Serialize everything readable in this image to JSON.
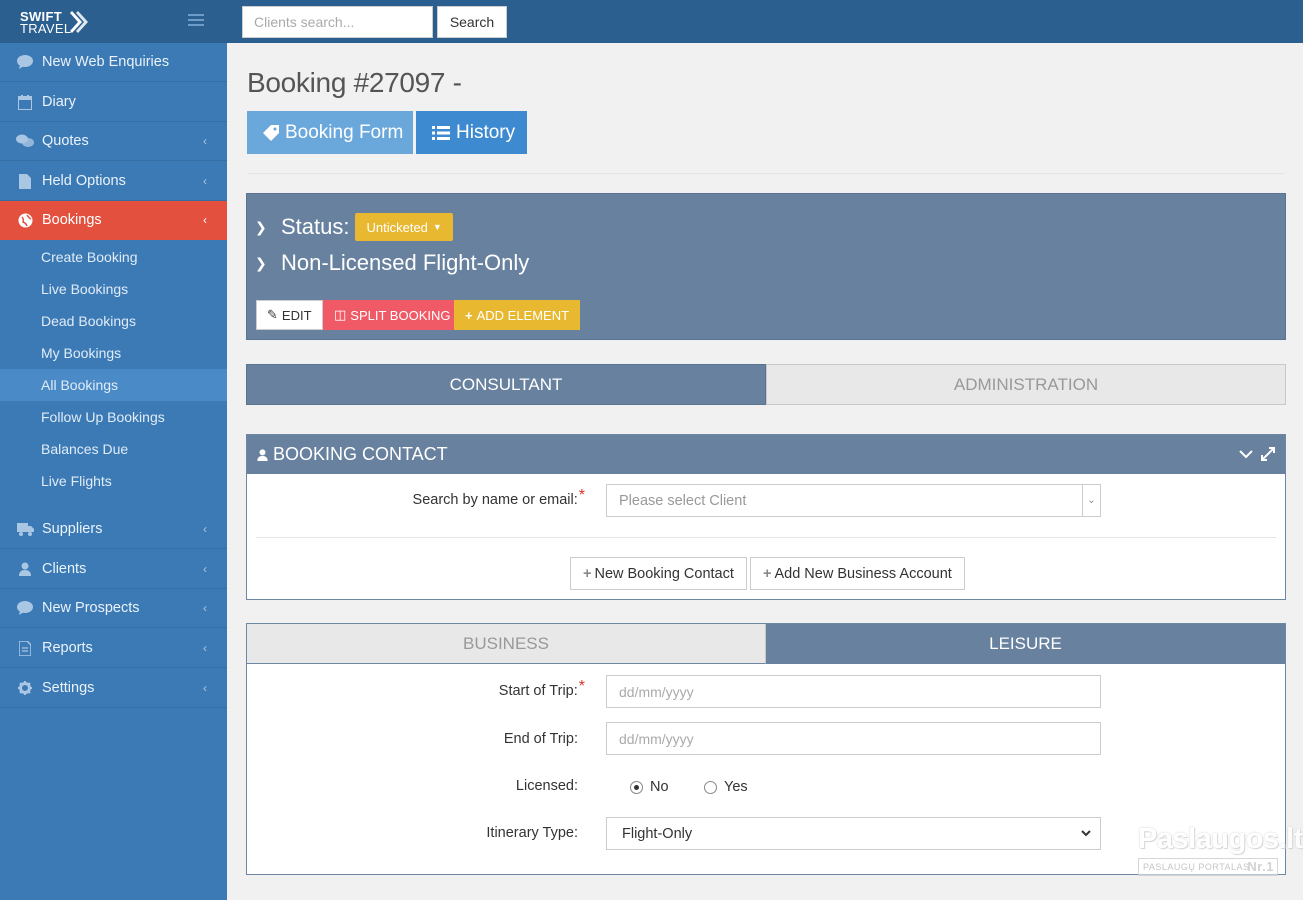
{
  "brand": {
    "line1": "SWIFT",
    "line2": "TRAVEL"
  },
  "topbar": {
    "search_placeholder": "Clients search...",
    "search_button": "Search"
  },
  "sidebar": {
    "items": [
      {
        "label": "New Web Enquiries",
        "icon": "comment-icon",
        "has_chevron": false
      },
      {
        "label": "Diary",
        "icon": "calendar-icon",
        "has_chevron": false
      },
      {
        "label": "Quotes",
        "icon": "comments-icon",
        "has_chevron": true
      },
      {
        "label": "Held Options",
        "icon": "file-icon",
        "has_chevron": true
      },
      {
        "label": "Bookings",
        "icon": "globe-icon",
        "has_chevron": true,
        "active": true
      },
      {
        "label": "Suppliers",
        "icon": "truck-icon",
        "has_chevron": true
      },
      {
        "label": "Clients",
        "icon": "user-icon",
        "has_chevron": true
      },
      {
        "label": "New Prospects",
        "icon": "comment-icon",
        "has_chevron": true
      },
      {
        "label": "Reports",
        "icon": "file-text-icon",
        "has_chevron": true
      },
      {
        "label": "Settings",
        "icon": "gear-icon",
        "has_chevron": true
      }
    ],
    "bookings_sub": [
      {
        "label": "Create Booking"
      },
      {
        "label": "Live Bookings"
      },
      {
        "label": "Dead Bookings"
      },
      {
        "label": "My Bookings"
      },
      {
        "label": "All Bookings",
        "current": true
      },
      {
        "label": "Follow Up Bookings"
      },
      {
        "label": "Balances Due"
      },
      {
        "label": "Live Flights"
      }
    ]
  },
  "page": {
    "title": "Booking #27097 -",
    "tabs": {
      "booking_form": "Booking Form",
      "history": "History"
    }
  },
  "status": {
    "label": "Status:",
    "badge": "Unticketed",
    "type": "Non-Licensed Flight-Only",
    "actions": {
      "edit": "EDIT",
      "split": "SPLIT BOOKING",
      "add": "ADD ELEMENT"
    }
  },
  "view_tabs": {
    "consultant": "CONSULTANT",
    "administration": "ADMINISTRATION"
  },
  "contact": {
    "title": "BOOKING CONTACT",
    "search_label": "Search by name or email:",
    "select_placeholder": "Please select Client",
    "new_contact": "New Booking Contact",
    "new_business": "Add New Business Account"
  },
  "trip": {
    "tabs": {
      "business": "BUSINESS",
      "leisure": "LEISURE"
    },
    "start_label": "Start of Trip:",
    "end_label": "End of Trip:",
    "date_placeholder": "dd/mm/yyyy",
    "licensed_label": "Licensed:",
    "licensed_no": "No",
    "licensed_yes": "Yes",
    "licensed_value": "No",
    "itinerary_label": "Itinerary Type:",
    "itinerary_value": "Flight-Only"
  },
  "watermark": {
    "main": "Paslaugos.lt",
    "sub": "PASLAUGŲ PORTALAS",
    "nr": "Nr.1"
  },
  "colors": {
    "sidebar": "#3c7ab5",
    "topbar": "#2a5f8f",
    "active_nav": "#e3503e",
    "panel": "#67819f",
    "warning": "#e8b830",
    "danger": "#ef5a66",
    "primary": "#3e8ad1"
  }
}
